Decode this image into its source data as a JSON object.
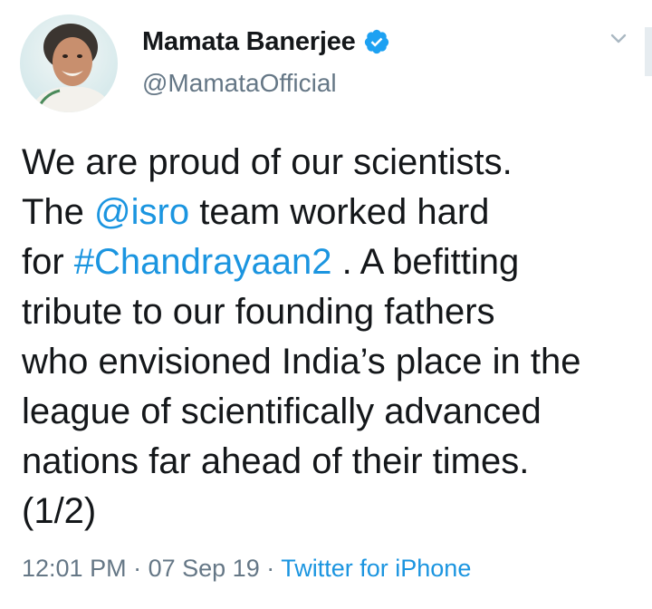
{
  "author": {
    "display_name": "Mamata Banerjee",
    "handle": "@MamataOfficial",
    "verified": true,
    "avatar_icon": "profile-photo",
    "verified_icon": "verified-badge-icon"
  },
  "tweet": {
    "lines": [
      [
        {
          "text": "We are proud of our scientists."
        }
      ],
      [
        {
          "text": "The "
        },
        {
          "text": "@isro",
          "link": true
        },
        {
          "text": " team worked hard"
        }
      ],
      [
        {
          "text": "for "
        },
        {
          "text": "#Chandrayaan2",
          "link": true
        },
        {
          "text": " . A befitting"
        }
      ],
      [
        {
          "text": "tribute to our founding fathers"
        }
      ],
      [
        {
          "text": "who envisioned India’s place in the"
        }
      ],
      [
        {
          "text": "league of scientifically advanced"
        }
      ],
      [
        {
          "text": "nations far ahead of their times."
        }
      ],
      [
        {
          "text": "(1/2)"
        }
      ]
    ]
  },
  "meta": {
    "time": "12:01 PM",
    "separator": "·",
    "date": "07 Sep 19",
    "source": "Twitter for iPhone"
  },
  "colors": {
    "link": "#1b95e0",
    "muted": "#657786",
    "text": "#14171a"
  },
  "menu_icon": "chevron-down-icon"
}
